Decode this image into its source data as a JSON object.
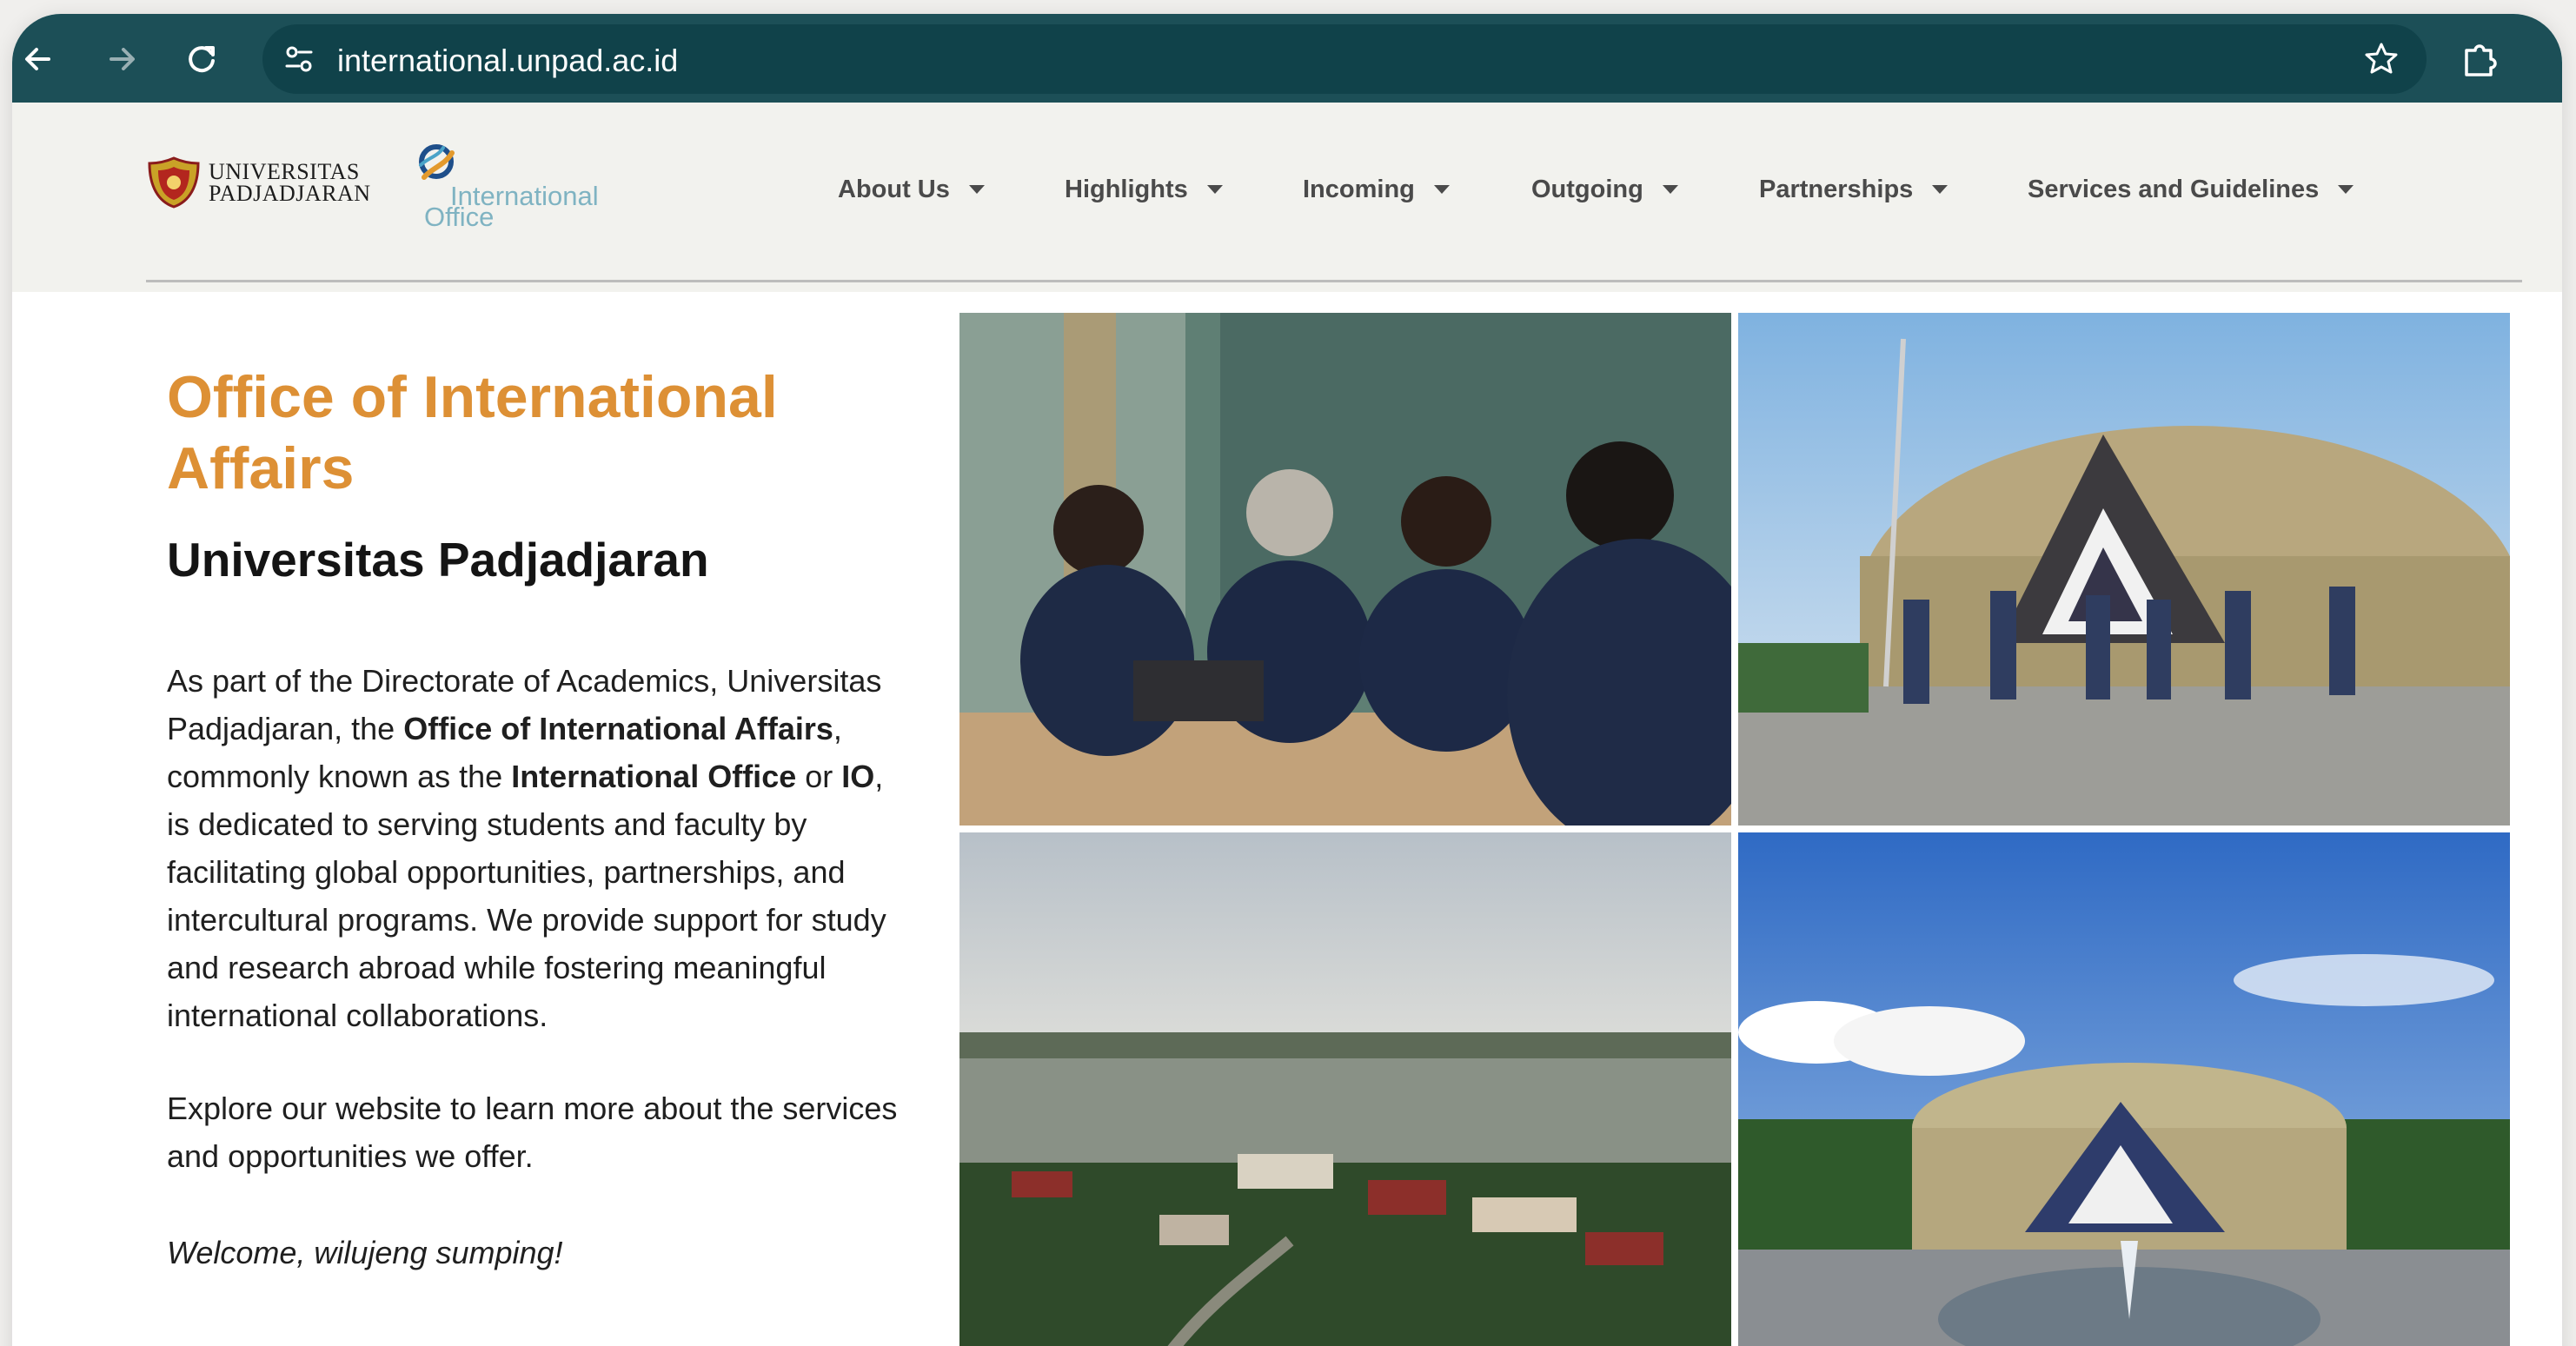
{
  "browser": {
    "url": "international.unpad.ac.id",
    "icons": {
      "back": "arrow-left-icon",
      "forward": "arrow-right-icon",
      "reload": "reload-icon",
      "site_info": "tune-icon",
      "bookmark": "star-icon",
      "extensions": "puzzle-icon"
    }
  },
  "header": {
    "unpad_logo": {
      "line1": "UNIVERSITAS",
      "line2": "PADJADJARAN"
    },
    "io_logo": {
      "line1": "International",
      "line2": "Office"
    },
    "nav": [
      {
        "label": "About Us"
      },
      {
        "label": "Highlights"
      },
      {
        "label": "Incoming"
      },
      {
        "label": "Outgoing"
      },
      {
        "label": "Partnerships"
      },
      {
        "label": "Services and Guidelines"
      }
    ]
  },
  "main": {
    "title_line1": "Office of International",
    "title_line2": "Affairs",
    "subtitle": "Universitas Padjadjaran",
    "intro": {
      "t1": "As part of the Directorate of Academics, Universitas Padjadjaran, the ",
      "b1": "Office of International Affairs",
      "t2": ", commonly known as the ",
      "b2": "International Office",
      "t3": " or ",
      "b3": "IO",
      "t4": ", is dedicated to serving students and faculty by facilitating global opportunities, partnerships, and intercultural programs. We provide support for study and research abroad while fostering meaningful international collaborations."
    },
    "explore": "Explore our website to learn more about the services and opportunities we offer.",
    "welcome": "Welcome, wilujeng sumping!"
  },
  "colors": {
    "toolbar_bg": "#1c4f57",
    "header_bg": "#f2f2ee",
    "title_orange": "#dd9035",
    "io_logo_blue": "#7fb3c2"
  }
}
